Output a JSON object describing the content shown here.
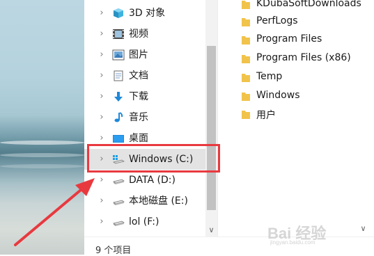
{
  "nav_pane": {
    "items": [
      {
        "label": "3D 对象",
        "icon": "3d-objects-icon"
      },
      {
        "label": "视频",
        "icon": "videos-icon"
      },
      {
        "label": "图片",
        "icon": "pictures-icon"
      },
      {
        "label": "文档",
        "icon": "documents-icon"
      },
      {
        "label": "下载",
        "icon": "downloads-icon"
      },
      {
        "label": "音乐",
        "icon": "music-icon"
      },
      {
        "label": "桌面",
        "icon": "desktop-icon"
      },
      {
        "label": "Windows (C:)",
        "icon": "windows-drive-icon"
      },
      {
        "label": "DATA (D:)",
        "icon": "drive-icon"
      },
      {
        "label": "本地磁盘 (E:)",
        "icon": "drive-icon"
      },
      {
        "label": "lol (F:)",
        "icon": "drive-icon"
      }
    ]
  },
  "content_pane": {
    "folders": [
      "KDubaSoftDownloads",
      "PerfLogs",
      "Program Files",
      "Program Files (x86)",
      "Temp",
      "Windows",
      "用户"
    ]
  },
  "status_bar": {
    "item_count": "9 个项目"
  },
  "watermark": {
    "text": "Bai 经验",
    "sub": "jingyan.baidu.com"
  },
  "colors": {
    "highlight": "#e8393f",
    "folder": "#f1c34a",
    "selected_bg": "#e3e3e3"
  }
}
